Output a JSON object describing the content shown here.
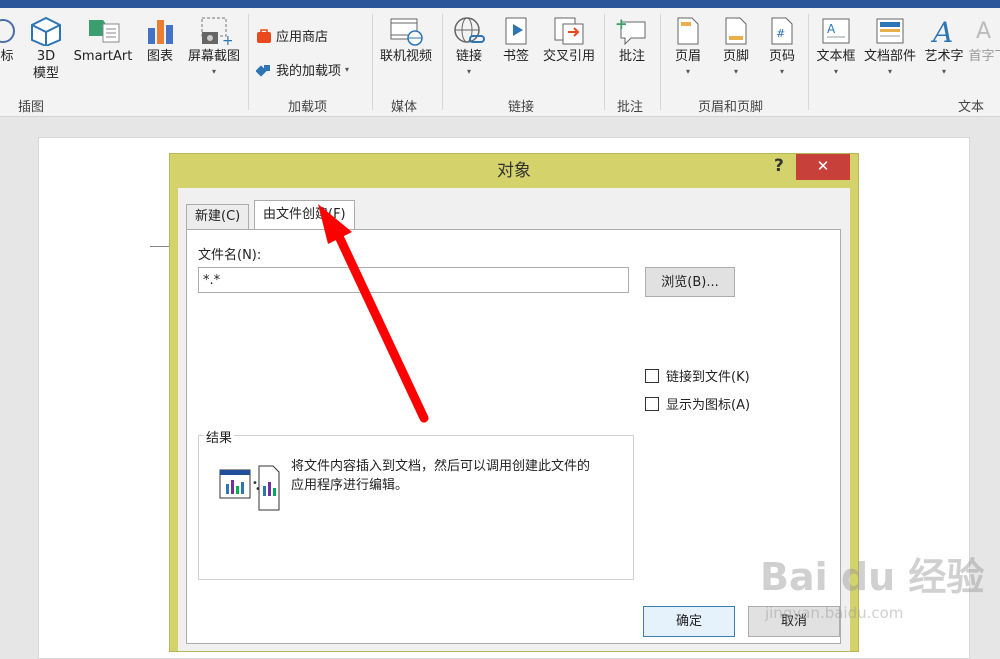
{
  "ribbon": {
    "buttons": [
      {
        "label": "标",
        "icon": "icons-icon"
      },
      {
        "label": "3D 模型",
        "icon": "cube-icon"
      },
      {
        "label": "SmartArt",
        "icon": "smartart-icon"
      },
      {
        "label": "图表",
        "icon": "chart-icon"
      },
      {
        "label": "屏幕截图",
        "icon": "screenshot-icon"
      },
      {
        "label": "联机视频",
        "icon": "video-icon"
      },
      {
        "label": "链接",
        "icon": "link-icon"
      },
      {
        "label": "书签",
        "icon": "bookmark-icon"
      },
      {
        "label": "交叉引用",
        "icon": "cross-reference-icon"
      },
      {
        "label": "批注",
        "icon": "comment-icon"
      },
      {
        "label": "页眉",
        "icon": "header-icon"
      },
      {
        "label": "页脚",
        "icon": "footer-icon"
      },
      {
        "label": "页码",
        "icon": "page-number-icon"
      },
      {
        "label": "文本框",
        "icon": "textbox-icon"
      },
      {
        "label": "文档部件",
        "icon": "quick-parts-icon"
      },
      {
        "label": "艺术字",
        "icon": "wordart-icon"
      },
      {
        "label": "首字下",
        "icon": "drop-cap-icon"
      }
    ],
    "addins": {
      "store": "应用商店",
      "myaddins": "我的加载项"
    },
    "groups": {
      "illustrations": "插图",
      "addins": "加载项",
      "media": "媒体",
      "links": "链接",
      "comments": "批注",
      "headerfooter": "页眉和页脚",
      "text": "文本"
    }
  },
  "dialog": {
    "title": "对象",
    "help": "?",
    "close": "✕",
    "tabs": {
      "new": "新建(C)",
      "from_file": "由文件创建(F)"
    },
    "filename_label": "文件名(N):",
    "filename_value": "*.*",
    "browse": "浏览(B)...",
    "link_to_file": "链接到文件(K)",
    "display_as_icon": "显示为图标(A)",
    "result_label": "结果",
    "result_text": "将文件内容插入到文档，然后可以调用创建此文件的应用程序进行编辑。",
    "ok": "确定",
    "cancel": "取消"
  },
  "watermark": {
    "brand": "Bai du 经验",
    "url": "jingyan.baidu.com"
  },
  "colors": {
    "dialog_frame": "#d4d36b",
    "close_button": "#c7403a",
    "arrow": "#ff0000",
    "title_bar": "#2b579a"
  }
}
